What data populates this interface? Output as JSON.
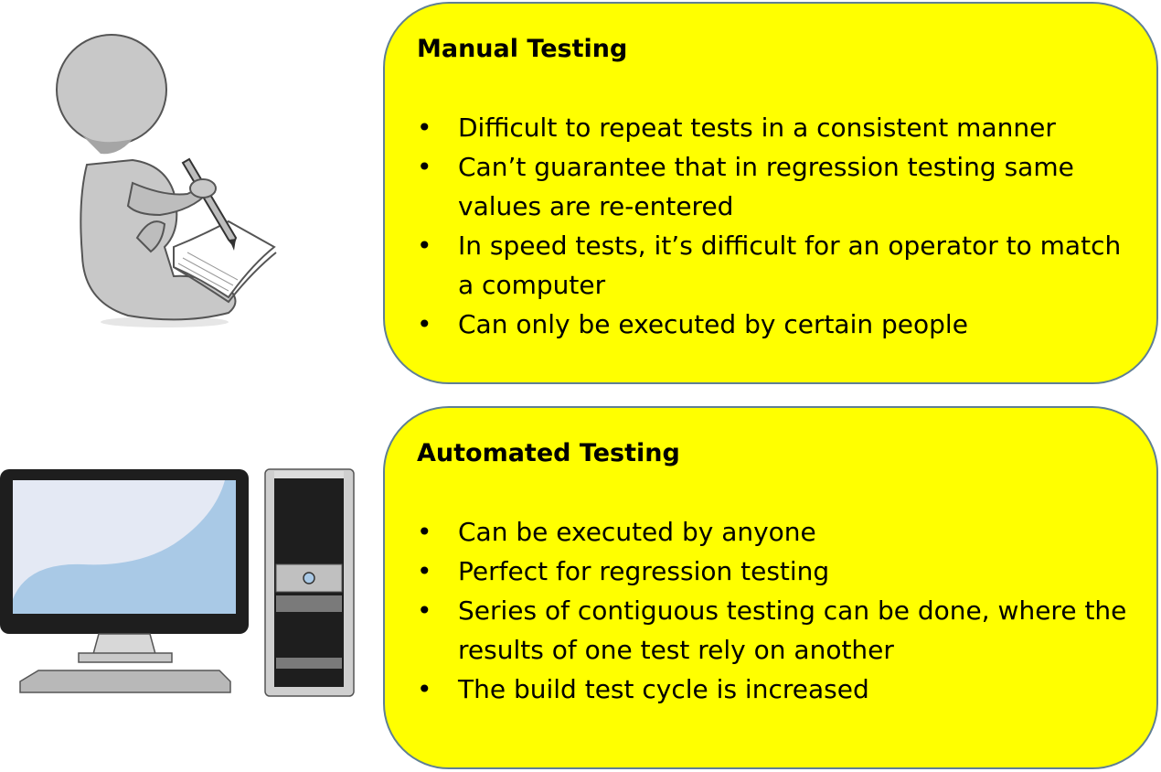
{
  "colors": {
    "panel_fill": "#ffff00",
    "panel_border": "#5f7f95",
    "figure_gray": "#c8c8c8",
    "figure_outline": "#555555",
    "screen_light": "#e4e9f4",
    "screen_blue": "#a9c9e6",
    "tower_dark": "#1e1e1e"
  },
  "manual": {
    "title": "Manual Testing",
    "bullets": [
      "Difficult to repeat tests in a consistent manner",
      "Can’t guarantee that in regression testing same values are re-entered",
      "In speed tests, it’s difficult for an operator to match a computer",
      "Can only be executed by certain people"
    ]
  },
  "automated": {
    "title": "Automated Testing",
    "bullets": [
      "Can be executed by anyone",
      "Perfect for regression testing",
      "Series of contiguous testing can be done, where the results of one test rely on another",
      "The build test cycle is increased"
    ]
  },
  "icons": {
    "person": "person-writing-icon",
    "computer": "desktop-computer-icon"
  }
}
